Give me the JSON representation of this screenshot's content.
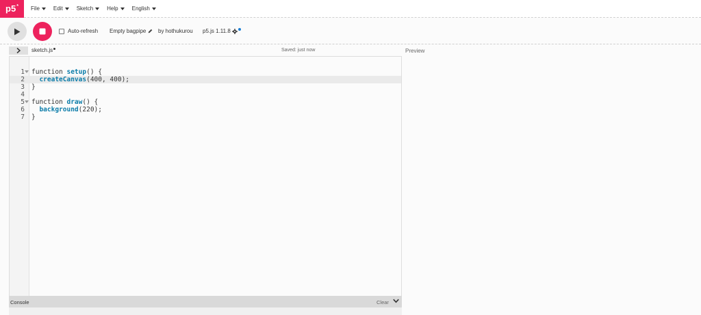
{
  "nav": {
    "logo": "p5",
    "logo_sup": "*",
    "menu": [
      {
        "label": "File"
      },
      {
        "label": "Edit"
      },
      {
        "label": "Sketch"
      },
      {
        "label": "Help"
      },
      {
        "label": "English"
      }
    ]
  },
  "toolbar": {
    "autorefresh_label": "Auto-refresh",
    "autorefresh_checked": false,
    "sketch_name": "Empty bagpipe",
    "byline": "by hothukurou",
    "version": "p5.js 1.11.8"
  },
  "editor": {
    "file_name": "sketch.js",
    "saved_status": "Saved: just now",
    "lines": [
      {
        "n": "1",
        "text": "function setup() {"
      },
      {
        "n": "2",
        "text": "  createCanvas(400, 400);"
      },
      {
        "n": "3",
        "text": "}"
      },
      {
        "n": "4",
        "text": ""
      },
      {
        "n": "5",
        "text": "function draw() {"
      },
      {
        "n": "6",
        "text": "  background(220);"
      },
      {
        "n": "7",
        "text": "}"
      }
    ]
  },
  "preview": {
    "label": "Preview"
  },
  "console": {
    "label": "Console",
    "clear_label": "Clear"
  },
  "colors": {
    "brand": "#ed225d",
    "function_blue": "#0b7ca9",
    "accent_dot": "#1c7fd6"
  }
}
